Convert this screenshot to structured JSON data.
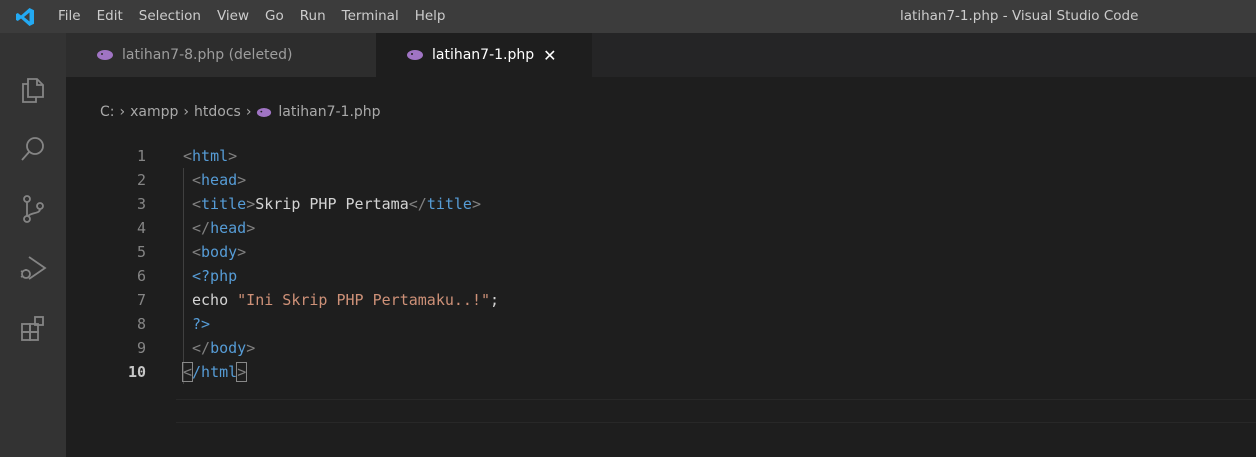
{
  "menu": [
    "File",
    "Edit",
    "Selection",
    "View",
    "Go",
    "Run",
    "Terminal",
    "Help"
  ],
  "window_title": "latihan7-1.php - Visual Studio Code",
  "tabs": [
    {
      "label": "latihan7-8.php (deleted)",
      "active": false
    },
    {
      "label": "latihan7-1.php",
      "active": true
    }
  ],
  "breadcrumb": [
    "C:",
    "xampp",
    "htdocs",
    "latihan7-1.php"
  ],
  "editor": {
    "current_line": 10,
    "lines": [
      {
        "num": "1",
        "parts": [
          [
            "punc",
            "<"
          ],
          [
            "tag",
            "html"
          ],
          [
            "punc",
            ">"
          ]
        ]
      },
      {
        "num": "2",
        "parts": [
          [
            "punc",
            "<"
          ],
          [
            "tag",
            "head"
          ],
          [
            "punc",
            ">"
          ]
        ]
      },
      {
        "num": "3",
        "parts": [
          [
            "punc",
            "<"
          ],
          [
            "tag",
            "title"
          ],
          [
            "punc",
            ">"
          ],
          [
            "kw",
            "Skrip PHP Pertama"
          ],
          [
            "punc",
            "</"
          ],
          [
            "tag",
            "title"
          ],
          [
            "punc",
            ">"
          ]
        ]
      },
      {
        "num": "4",
        "parts": [
          [
            "punc",
            "</"
          ],
          [
            "tag",
            "head"
          ],
          [
            "punc",
            ">"
          ]
        ]
      },
      {
        "num": "5",
        "parts": [
          [
            "punc",
            "<"
          ],
          [
            "tag",
            "body"
          ],
          [
            "punc",
            ">"
          ]
        ]
      },
      {
        "num": "6",
        "parts": [
          [
            "tag",
            "<?php"
          ]
        ]
      },
      {
        "num": "7",
        "parts": [
          [
            "kw",
            "echo "
          ],
          [
            "str",
            "\"Ini Skrip PHP Pertamaku..!\""
          ],
          [
            "kw",
            ";"
          ]
        ]
      },
      {
        "num": "8",
        "parts": [
          [
            "tag",
            "?>"
          ]
        ]
      },
      {
        "num": "9",
        "parts": [
          [
            "punc",
            "</"
          ],
          [
            "tag",
            "body"
          ],
          [
            "punc",
            ">"
          ]
        ]
      },
      {
        "num": "10",
        "parts": [
          [
            "punc",
            "<"
          ],
          [
            "tag",
            "/html"
          ],
          [
            "punc",
            ">"
          ]
        ]
      }
    ]
  },
  "colors": {
    "titlebar": "#3c3c3c",
    "activitybar": "#333333",
    "editor_bg": "#1e1e1e",
    "tag": "#569cd6",
    "string": "#ce9178",
    "php_icon": "#a074c4",
    "vscode_blue": "#23a9f2"
  },
  "icons": {
    "activity": [
      "explorer-icon",
      "search-icon",
      "source-control-icon",
      "run-debug-icon",
      "extensions-icon"
    ]
  }
}
